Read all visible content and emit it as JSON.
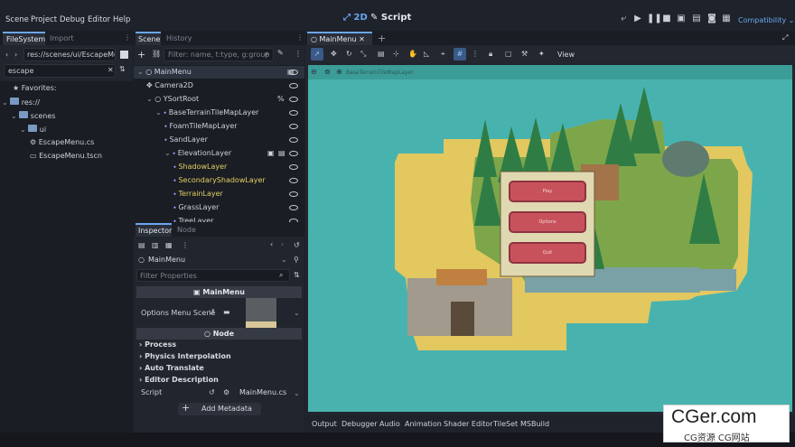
{
  "menubar": {
    "items": [
      "Scene",
      "Project",
      "Debug",
      "Editor",
      "Help"
    ],
    "mode_2d": "2D",
    "mode_script": "Script",
    "renderer": "Compatibility"
  },
  "filesystem": {
    "tabs": [
      "FileSystem",
      "Import"
    ],
    "path": "res://scenes/ui/EscapeMenu.",
    "search": "escape",
    "tree": [
      {
        "label": "Favorites:",
        "icon": "star-icon",
        "indent": 0
      },
      {
        "label": "res://",
        "icon": "folder-icon",
        "indent": 0
      },
      {
        "label": "scenes",
        "icon": "folder-icon",
        "indent": 1
      },
      {
        "label": "ui",
        "icon": "folder-icon",
        "indent": 2
      },
      {
        "label": "EscapeMenu.cs",
        "icon": "gear-icon",
        "indent": 3
      },
      {
        "label": "EscapeMenu.tscn",
        "icon": "scene-icon",
        "indent": 3
      }
    ]
  },
  "scene": {
    "tabs": [
      "Scene",
      "History"
    ],
    "filter_placeholder": "Filter: name, t:type, g:group",
    "nodes": [
      {
        "label": "MainMenu",
        "level": 0,
        "highlight": false
      },
      {
        "label": "Camera2D",
        "level": 1,
        "highlight": false
      },
      {
        "label": "YSortRoot",
        "level": 1,
        "highlight": false
      },
      {
        "label": "BaseTerrainTileMapLayer",
        "level": 2,
        "highlight": false
      },
      {
        "label": "FoamTileMapLayer",
        "level": 3,
        "highlight": false
      },
      {
        "label": "SandLayer",
        "level": 3,
        "highlight": false
      },
      {
        "label": "ElevationLayer",
        "level": 3,
        "highlight": false
      },
      {
        "label": "ShadowLayer",
        "level": 4,
        "highlight": true
      },
      {
        "label": "SecondaryShadowLayer",
        "level": 4,
        "highlight": true
      },
      {
        "label": "TerrainLayer",
        "level": 4,
        "highlight": true
      },
      {
        "label": "GrassLayer",
        "level": 4,
        "highlight": false
      },
      {
        "label": "TreeLayer",
        "level": 4,
        "highlight": false
      }
    ]
  },
  "inspector": {
    "tabs": [
      "Inspector",
      "Node"
    ],
    "object": "MainMenu",
    "filter_placeholder": "Filter Properties",
    "class_header": "MainMenu",
    "options_label": "Options Menu Scene",
    "node_header": "Node",
    "sections": [
      "Process",
      "Physics Interpolation",
      "Auto Translate",
      "Editor Description"
    ],
    "script_label": "Script",
    "script_value": "MainMenu.cs",
    "add_metadata": "Add Metadata"
  },
  "viewport": {
    "tab": "MainMenu",
    "view_label": "View",
    "overlay_label": "BaseTerrainTileMapLayer",
    "menu_buttons": [
      "Play",
      "Options",
      "Quit"
    ]
  },
  "bottom_tabs": [
    "Output",
    "Debugger",
    "Audio",
    "Animation",
    "Shader Editor",
    "TileSet",
    "MSBuild"
  ],
  "watermark": {
    "main": "CGer.com",
    "sub": "CG资源 CG网站"
  }
}
